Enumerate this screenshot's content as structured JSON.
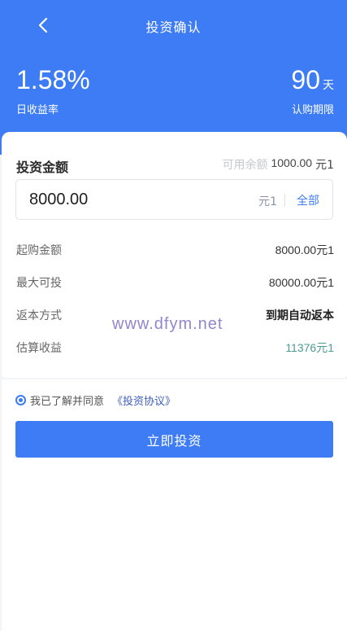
{
  "nav": {
    "title": "投资确认"
  },
  "summary": {
    "rate_value": "1.58%",
    "rate_label": "日收益率",
    "period_value": "90",
    "period_unit": "天",
    "period_label": "认购期限"
  },
  "amount": {
    "title": "投资金额",
    "balance_label": "可用余额",
    "balance_value": "1000.00",
    "balance_unit": "元1",
    "input_value": "8000.00",
    "input_unit": "元1",
    "all_label": "全部"
  },
  "info": [
    {
      "label": "起购金额",
      "value": "8000.00元1"
    },
    {
      "label": "最大可投",
      "value": "80000.00元1"
    },
    {
      "label": "返本方式",
      "value": "到期自动返本"
    },
    {
      "label": "估算收益",
      "value": "11376元1"
    }
  ],
  "watermark": "www.dfym.net",
  "agreement": {
    "text": "我已了解并同意",
    "link": "《投资协议》"
  },
  "submit_label": "立即投资",
  "colors": {
    "primary": "#3d7cf5",
    "estimate": "#4e9b8f"
  },
  "icons": {
    "back": "chevron-left-icon"
  }
}
